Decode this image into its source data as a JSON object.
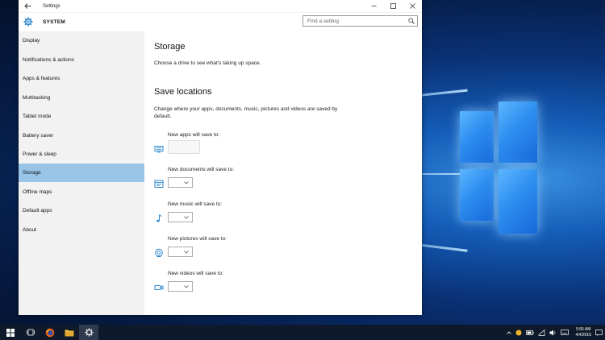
{
  "window": {
    "title": "Settings",
    "section_title": "SYSTEM",
    "search_placeholder": "Find a setting"
  },
  "sidebar": {
    "items": [
      {
        "label": "Display"
      },
      {
        "label": "Notifications & actions"
      },
      {
        "label": "Apps & features"
      },
      {
        "label": "Multitasking"
      },
      {
        "label": "Tablet mode"
      },
      {
        "label": "Battery saver"
      },
      {
        "label": "Power & sleep"
      },
      {
        "label": "Storage",
        "selected": true
      },
      {
        "label": "Offline maps"
      },
      {
        "label": "Default apps"
      },
      {
        "label": "About"
      }
    ]
  },
  "main": {
    "heading": "Storage",
    "subtext": "Choose a drive to see what's taking up space.",
    "save_heading": "Save locations",
    "save_desc": "Change where your apps, documents, music, pictures and videos are saved by default.",
    "locations": [
      {
        "label": "New apps will save to:",
        "icon": "app-icon",
        "value": ""
      },
      {
        "label": "New documents will save to:",
        "icon": "document-icon",
        "value": ""
      },
      {
        "label": "New music will save to:",
        "icon": "music-icon",
        "value": ""
      },
      {
        "label": "New pictures will save to:",
        "icon": "picture-icon",
        "value": ""
      },
      {
        "label": "New videos will save to:",
        "icon": "video-icon",
        "value": ""
      }
    ]
  },
  "taskbar": {
    "time": "5:55 AM",
    "date": "4/4/2016"
  },
  "colors": {
    "accent": "#1579c9",
    "selected_nav": "#98c4e8",
    "taskbar": "#0e1a2b"
  }
}
